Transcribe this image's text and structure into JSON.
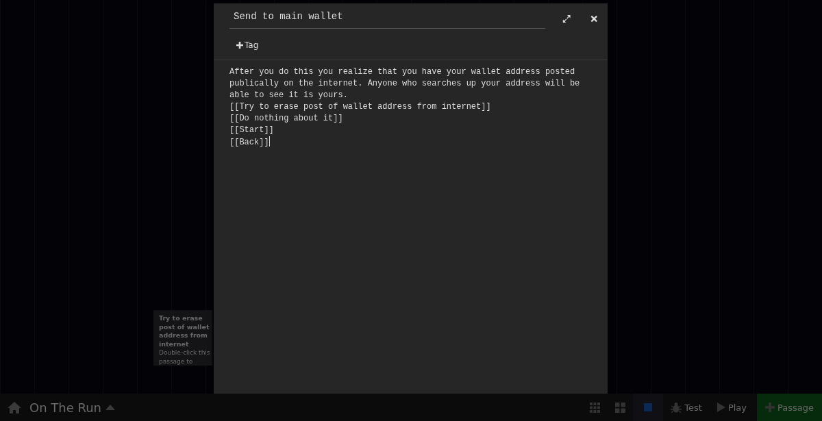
{
  "story_map": {
    "hover_passage": {
      "title": "Try to erase post of wallet address from internet",
      "hint": "Double-click this passage to"
    }
  },
  "dialog": {
    "title": "Send to main wallet",
    "tag_button": "Tag",
    "body_lines": [
      "After you do this you realize that you have your wallet address posted publically on the internet. Anyone who searches up your address will be able to see it is yours.",
      "[[Try to erase post of wallet address from internet]]",
      "[[Do nothing about it]]",
      "[[Start]]",
      "[[Back]]"
    ]
  },
  "toolbar": {
    "story_title": "On The Run",
    "buttons": [
      {
        "kind": "grid"
      },
      {
        "kind": "tiles"
      },
      {
        "kind": "square"
      },
      {
        "kind": "test",
        "label": "Test"
      },
      {
        "kind": "play",
        "label": "Play"
      },
      {
        "kind": "passage",
        "label": "Passage"
      }
    ]
  }
}
